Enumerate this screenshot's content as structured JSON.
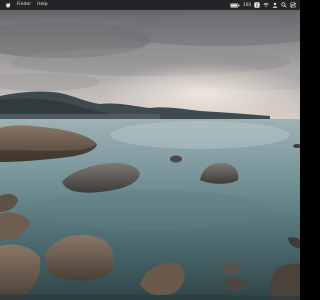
{
  "menubar": {
    "app_name": "Finder",
    "menu_items": [
      "Help"
    ],
    "status": {
      "battery_label": "100"
    }
  },
  "icons": {
    "apple": "apple-logo-icon",
    "battery": "battery-icon",
    "info": "info-icon",
    "wifi": "wifi-icon",
    "user": "user-icon",
    "search": "search-icon",
    "control_center": "control-center-icon"
  },
  "wallpaper": {
    "description_color_sky": "#8a8a8c",
    "description_color_water": "#3f5a5e"
  }
}
